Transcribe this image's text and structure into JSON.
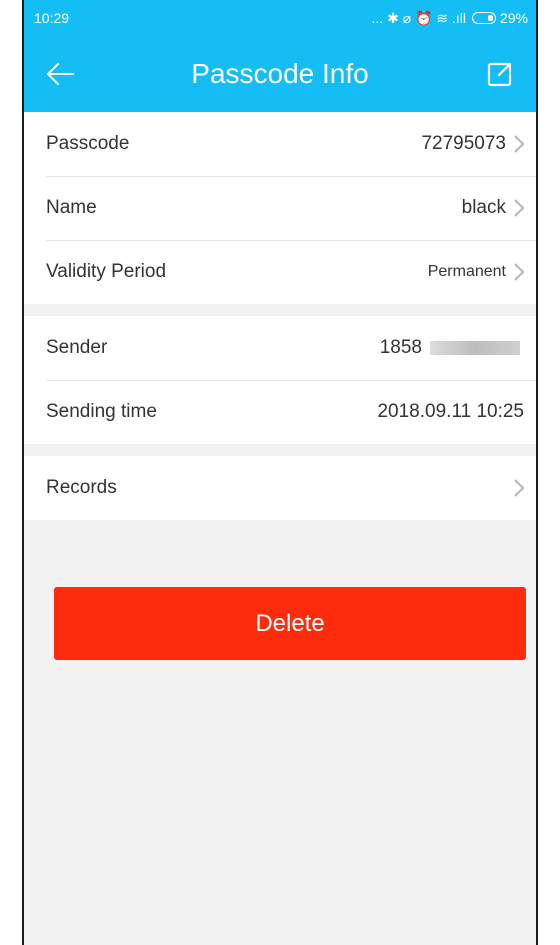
{
  "status_bar": {
    "time": "10:29",
    "icons": "... ✱ ⌀ ⏰ ≋ .ıll",
    "battery": "29%"
  },
  "header": {
    "title": "Passcode Info",
    "back_icon": "back-arrow-icon",
    "share_icon": "external-link-icon"
  },
  "passcode_section": {
    "rows": [
      {
        "label": "Passcode",
        "value": "72795073"
      },
      {
        "label": "Name",
        "value": "black"
      },
      {
        "label": "Validity Period",
        "value": "Permanent"
      }
    ]
  },
  "sender_section": {
    "rows": [
      {
        "label": "Sender",
        "value": "1858"
      },
      {
        "label": "Sending time",
        "value": "2018.09.11 10:25"
      }
    ]
  },
  "records": {
    "label": "Records"
  },
  "actions": {
    "delete_label": "Delete"
  },
  "colors": {
    "primary": "#14bdf4",
    "danger": "#fe2b0d",
    "background": "#f2f2f2"
  }
}
